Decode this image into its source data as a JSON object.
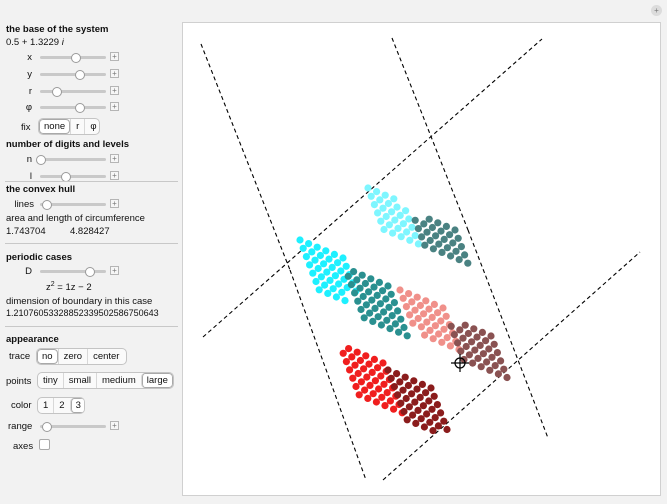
{
  "window": {
    "close_glyph": "+"
  },
  "base": {
    "title": "the base of the system",
    "value_re": "0.5 + 1.3229",
    "value_im": "i",
    "sliders": [
      {
        "label": "x",
        "value": 0.55
      },
      {
        "label": "y",
        "value": 0.6
      },
      {
        "label": "r",
        "value": 0.25
      },
      {
        "label": "φ",
        "value": 0.6
      }
    ],
    "fix_label": "fix",
    "fix_options": [
      "none",
      "r",
      "φ"
    ],
    "fix_selected": "none"
  },
  "digits": {
    "title": "number of digits and levels",
    "sliders": [
      {
        "label": "n",
        "value": 0.02
      },
      {
        "label": "l",
        "value": 0.4
      }
    ]
  },
  "hull": {
    "title": "the convex hull",
    "lines_label": "lines",
    "lines_value": 0.1,
    "area_label": "area and length of circumference",
    "area_value": "1.743704",
    "length_value": "4.828427"
  },
  "periodic": {
    "title": "periodic cases",
    "d_label": "D",
    "d_value": 0.75,
    "equation_lhs": "z",
    "equation_exp": "2",
    "equation_rhs": " = 1z − 2",
    "dim_label": "dimension of boundary in this case",
    "dim_value": "1.210760533288523395025867506​43"
  },
  "appearance": {
    "title": "appearance",
    "trace_label": "trace",
    "trace_options": [
      "no",
      "zero",
      "center"
    ],
    "trace_selected": "no",
    "points_label": "points",
    "points_options": [
      "tiny",
      "small",
      "medium",
      "large"
    ],
    "points_selected": "large",
    "color_label": "color",
    "color_options": [
      "1",
      "2",
      "3"
    ],
    "color_selected": "3",
    "range_label": "range",
    "range_value": 0.1,
    "axes_label": "axes",
    "axes_checked": false
  },
  "plot": {
    "colors": {
      "cyan": "#1ef0ff",
      "light_cyan": "#7ef6ff",
      "teal": "#2a9090",
      "dark_teal": "#4a8282",
      "salmon": "#f0908a",
      "red": "#f01e1e",
      "dark_red": "#8b1c1c",
      "mauve": "#8a5252"
    },
    "cursor_icon": "crosshair-icon"
  }
}
